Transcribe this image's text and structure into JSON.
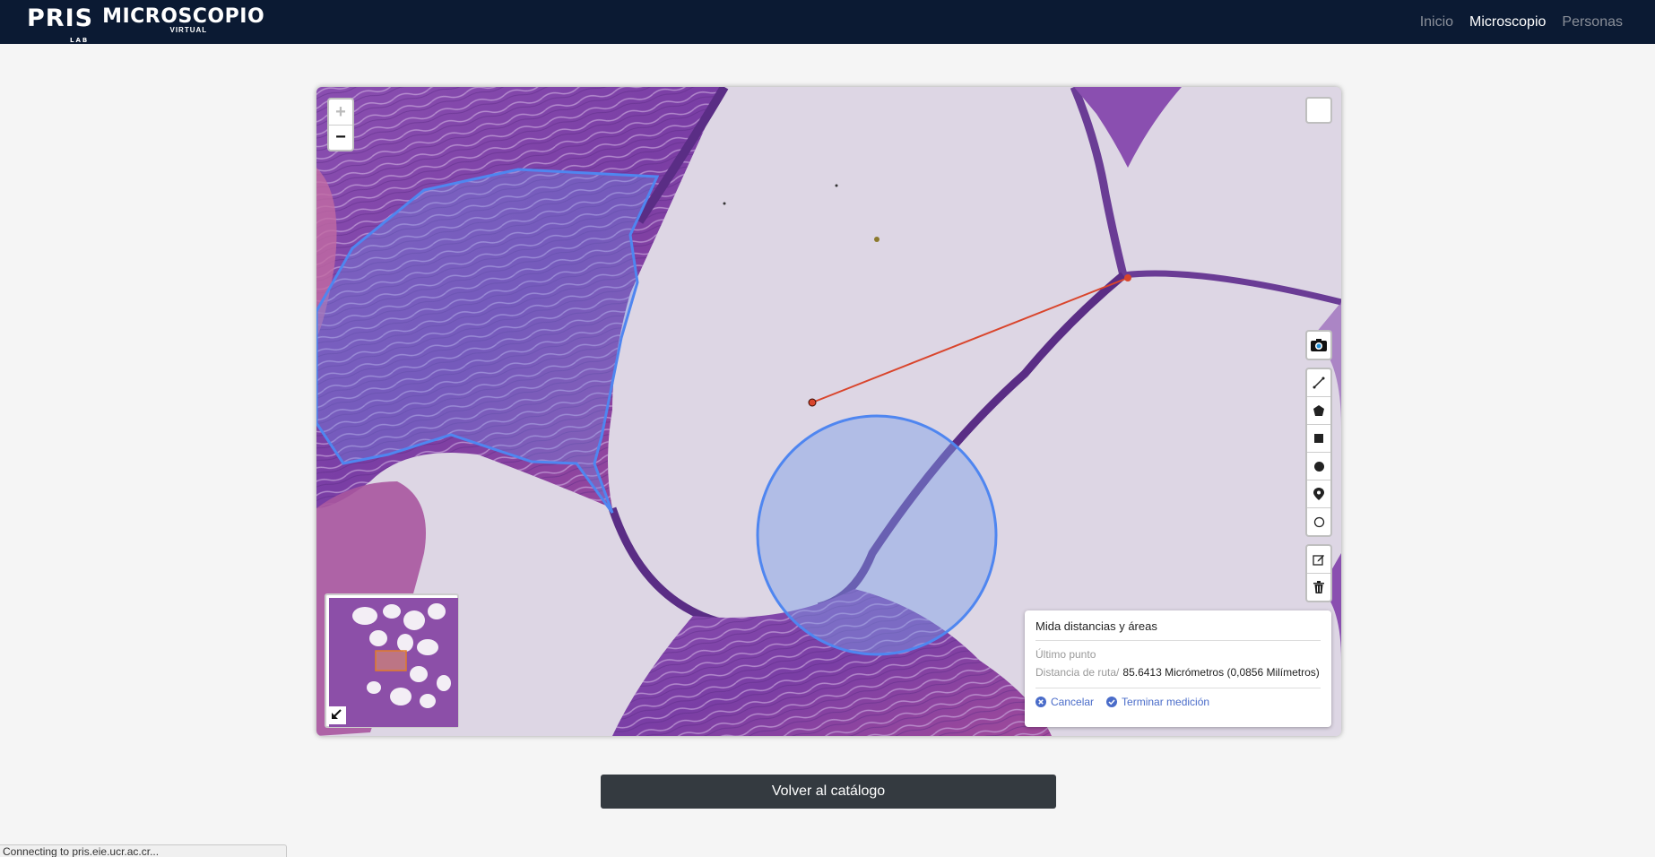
{
  "navbar": {
    "brand_pris": "PRIS",
    "brand_lab": "LAB",
    "brand_title": "MICROSCOPIO",
    "brand_subtitle": "VIRTUAL",
    "links": [
      {
        "label": "Inicio",
        "active": false
      },
      {
        "label": "Microscopio",
        "active": true
      },
      {
        "label": "Personas",
        "active": false
      }
    ]
  },
  "viewer": {
    "zoom_in": "+",
    "zoom_out": "−",
    "tools": [
      "camera-icon",
      "polyline-icon",
      "polygon-icon",
      "rectangle-icon",
      "circle-icon",
      "marker-icon",
      "circle-marker-icon"
    ],
    "edit_tools": [
      "edit-icon",
      "trash-icon"
    ],
    "annotation_colors": {
      "shape": "#3b82f6",
      "measure": "#d9452c"
    }
  },
  "measure": {
    "title": "Mida distancias y áreas",
    "last_point_label": "Último punto",
    "path_distance_label": "Distancia de ruta/",
    "path_distance_value": "85.6413 Micrómetros (0,0856 Milímetros)",
    "cancel_label": "Cancelar",
    "finish_label": "Terminar medición",
    "accent_color": "#4a6cc9"
  },
  "footer": {
    "back_button": "Volver al catálogo"
  },
  "status": {
    "text": "Connecting to pris.eie.ucr.ac.cr..."
  }
}
